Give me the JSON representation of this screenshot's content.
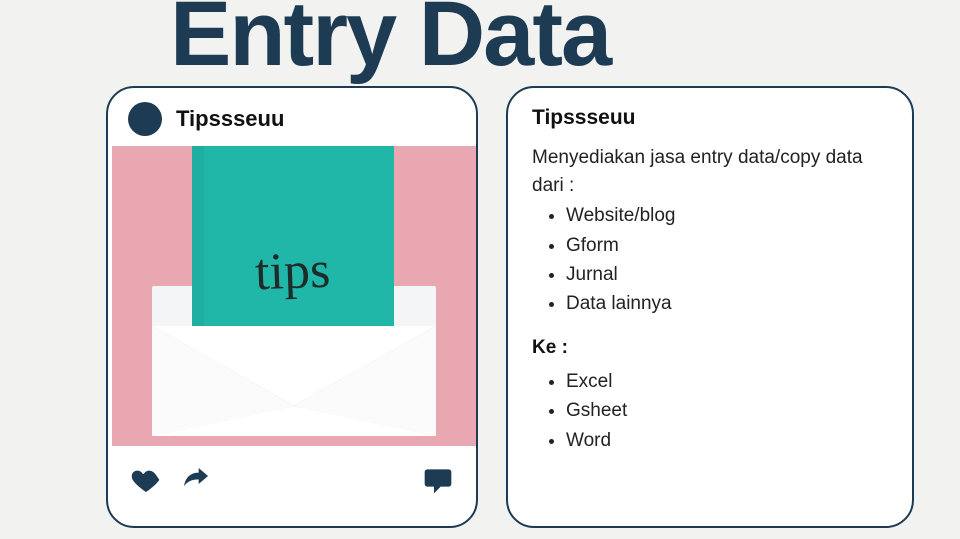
{
  "title": "Entry Data",
  "left_card": {
    "username": "Tipssseuu",
    "image_text": "tips"
  },
  "right_card": {
    "title": "Tipssseuu",
    "intro": "Menyediakan jasa entry data/copy data dari :",
    "from_items": [
      "Website/blog",
      "Gform",
      "Jurnal",
      "Data lainnya"
    ],
    "ke_label": "Ke :",
    "to_items": [
      "Excel",
      "Gsheet",
      "Word"
    ]
  }
}
